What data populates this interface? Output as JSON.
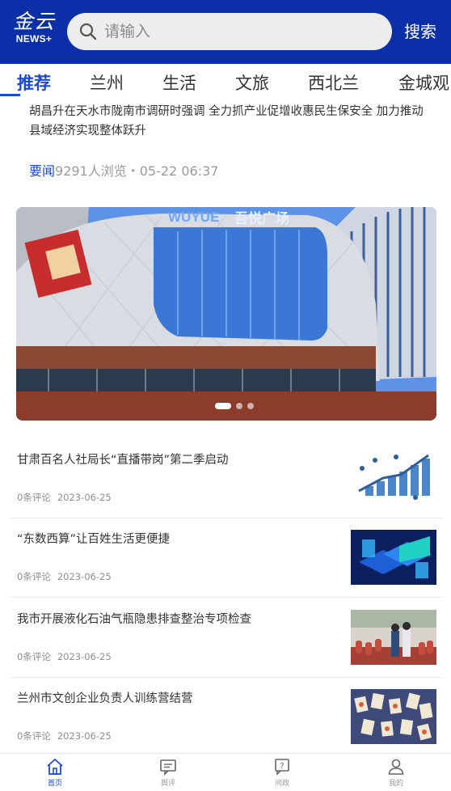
{
  "header": {
    "logo_main": "金云",
    "logo_sub": "NEWS+",
    "search_placeholder": "请输入",
    "search_button": "搜索"
  },
  "tabs": [
    {
      "label": "推荐",
      "active": true
    },
    {
      "label": "兰州"
    },
    {
      "label": "生活"
    },
    {
      "label": "文旅"
    },
    {
      "label": "西北兰"
    },
    {
      "label": "金城观"
    }
  ],
  "headline": {
    "title": "胡昌升在天水市陇南市调研时强调 全力抓产业促增收惠民生保安全 加力推动县域经济实现整体跃升",
    "tag": "要闻",
    "meta": "9291人浏览・05-22 06:37"
  },
  "banner": {
    "signage": "WUYUE 吾悦广场",
    "slide_count": 3,
    "active_slide": 1
  },
  "news": [
    {
      "title": "甘肃百名人社局长“直播带岗”第二季启动",
      "comments": "0条评论",
      "date": "2023-06-25",
      "thumb": "growth-chart-icon"
    },
    {
      "title": "“东数西算”让百姓生活更便捷",
      "comments": "0条评论",
      "date": "2023-06-25",
      "thumb": "east-data-west-compute-image"
    },
    {
      "title": "我市开展液化石油气瓶隐患排查整治专项检查",
      "comments": "0条评论",
      "date": "2023-06-25",
      "thumb": "gas-cylinder-inspection-photo"
    },
    {
      "title": "兰州市文创企业负责人训练营结营",
      "comments": "0条评论",
      "date": "2023-06-25",
      "thumb": "cultural-products-photo"
    }
  ],
  "bottom_nav": [
    {
      "label": "首页",
      "icon": "home-icon",
      "active": true
    },
    {
      "label": "舆评",
      "icon": "chat-icon"
    },
    {
      "label": "问政",
      "icon": "question-icon"
    },
    {
      "label": "我的",
      "icon": "user-icon"
    }
  ],
  "colors": {
    "brand_blue": "#0b2fa9",
    "accent_blue": "#1b49d3"
  }
}
